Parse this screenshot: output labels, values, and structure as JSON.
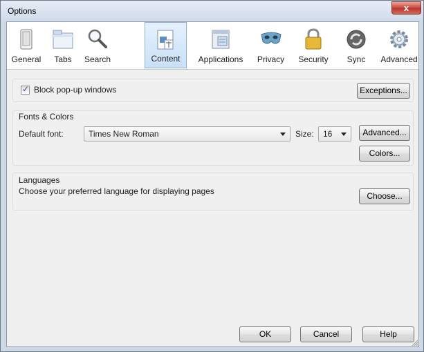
{
  "window": {
    "title": "Options",
    "close_label": "x"
  },
  "toolbar": {
    "tabs": [
      {
        "label": "General",
        "icon": "switch-icon"
      },
      {
        "label": "Tabs",
        "icon": "tabs-window-icon"
      },
      {
        "label": "Search",
        "icon": "magnifier-icon"
      },
      {
        "label": "Content",
        "icon": "content-page-icon",
        "active": true
      },
      {
        "label": "Applications",
        "icon": "applications-window-icon"
      },
      {
        "label": "Privacy",
        "icon": "privacy-mask-icon"
      },
      {
        "label": "Security",
        "icon": "padlock-icon"
      },
      {
        "label": "Sync",
        "icon": "sync-arrows-icon"
      },
      {
        "label": "Advanced",
        "icon": "gear-icon"
      }
    ]
  },
  "content": {
    "popup": {
      "label": "Block pop-up windows",
      "checked": true,
      "exceptions_label": "Exceptions..."
    },
    "fonts": {
      "heading": "Fonts & Colors",
      "default_font_label": "Default font:",
      "default_font_value": "Times New Roman",
      "size_label": "Size:",
      "size_value": "16",
      "advanced_label": "Advanced...",
      "colors_label": "Colors..."
    },
    "languages": {
      "heading": "Languages",
      "description": "Choose your preferred language for displaying pages",
      "choose_label": "Choose..."
    }
  },
  "footer": {
    "ok_label": "OK",
    "cancel_label": "Cancel",
    "help_label": "Help"
  },
  "colors": {
    "accent": "#c9e0f8",
    "close": "#c7473a"
  }
}
